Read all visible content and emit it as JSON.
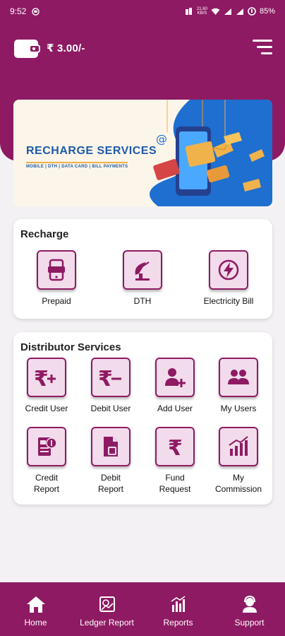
{
  "status_bar": {
    "time": "9:52",
    "net_speed": "21.60",
    "net_unit": "KB/S",
    "battery": "85%"
  },
  "wallet": {
    "amount": "₹ 3.00/-"
  },
  "banner": {
    "title": "RECHARGE SERVICES",
    "subtitle": "MOBILE | DTH | DATA CARD | BILL PAYMENTS"
  },
  "recharge": {
    "title": "Recharge",
    "items": [
      {
        "label": "Prepaid",
        "icon": "mobile-recharge-icon"
      },
      {
        "label": "DTH",
        "icon": "dish-antenna-icon"
      },
      {
        "label": "Electricity Bill",
        "icon": "lightning-bolt-icon"
      }
    ]
  },
  "distributor": {
    "title": "Distributor Services",
    "items": [
      {
        "label": "Credit User",
        "icon": "rupee-plus-icon"
      },
      {
        "label": "Debit User",
        "icon": "rupee-minus-icon"
      },
      {
        "label": "Add User",
        "icon": "add-user-icon"
      },
      {
        "label": "My Users",
        "icon": "users-icon"
      },
      {
        "label1": "Credit",
        "label2": "Report",
        "icon": "credit-report-icon"
      },
      {
        "label1": "Debit",
        "label2": "Report",
        "icon": "debit-report-icon"
      },
      {
        "label1": "Fund",
        "label2": "Request",
        "icon": "rupee-icon"
      },
      {
        "label1": "My",
        "label2": "Commission",
        "icon": "growth-chart-icon"
      }
    ]
  },
  "bottom_nav": [
    {
      "label": "Home",
      "icon": "home-icon"
    },
    {
      "label": "Ledger Report",
      "icon": "ledger-icon"
    },
    {
      "label": "Reports",
      "icon": "bar-chart-icon"
    },
    {
      "label": "Support",
      "icon": "support-agent-icon"
    }
  ],
  "colors": {
    "primary": "#8e1a63",
    "tile_bg": "#f2dbeb",
    "banner_title": "#1e5aa8"
  }
}
